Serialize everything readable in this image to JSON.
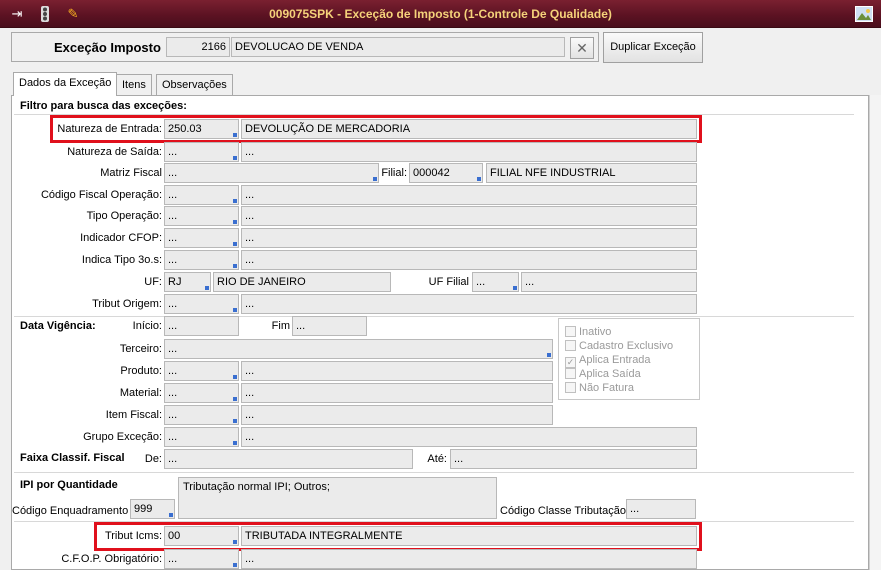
{
  "window": {
    "title": "009075SPK - Exceção de Imposto (1-Controle De Qualidade)",
    "icons": [
      "exit-icon",
      "traffic-light-icon",
      "tools-icon",
      "picture-icon"
    ]
  },
  "header": {
    "label": "Exceção Imposto",
    "code": "2166",
    "description": "DEVOLUCAO DE VENDA",
    "clear_symbol": "✕",
    "duplicate_button": "Duplicar Exceção"
  },
  "tabs": [
    "Dados da Exceção",
    "Itens",
    "Observações"
  ],
  "filter": {
    "section_title": "Filtro para busca das exceções:",
    "natureza_entrada": {
      "label": "Natureza de Entrada:",
      "code": "250.03",
      "desc": "DEVOLUÇÃO DE MERCADORIA"
    },
    "natureza_saida": {
      "label": "Natureza de Saída:",
      "code": "...",
      "desc": "..."
    },
    "matriz_fiscal": {
      "label": "Matriz Fiscal",
      "code": "..."
    },
    "filial": {
      "label": "Filial:",
      "code": "000042",
      "desc": "FILIAL NFE INDUSTRIAL"
    },
    "codigo_fiscal_operacao": {
      "label": "Código Fiscal Operação:",
      "code": "...",
      "desc": "..."
    },
    "tipo_operacao": {
      "label": "Tipo Operação:",
      "code": "...",
      "desc": "..."
    },
    "indicador_cfop": {
      "label": "Indicador CFOP:",
      "code": "...",
      "desc": "..."
    },
    "indica_tipo": {
      "label": "Indica Tipo 3o.s:",
      "code": "...",
      "desc": "..."
    },
    "uf": {
      "label": "UF:",
      "code": "RJ",
      "desc": "RIO DE JANEIRO"
    },
    "uf_filial": {
      "label": "UF Filial",
      "code": "...",
      "desc": "..."
    },
    "tribut_origem": {
      "label": "Tribut Origem:",
      "code": "...",
      "desc": "..."
    }
  },
  "vigencia": {
    "title": "Data Vigência:",
    "inicio_label": "Início:",
    "inicio": "...",
    "fim_label": "Fim",
    "fim": "..."
  },
  "checkboxes": [
    {
      "label": "Inativo",
      "checked": false
    },
    {
      "label": "Cadastro Exclusivo",
      "checked": false
    },
    {
      "label": "Aplica Entrada",
      "checked": true
    },
    {
      "label": "Aplica Saída",
      "checked": false
    },
    {
      "label": "Não Fatura",
      "checked": false
    }
  ],
  "others": {
    "terceiro": {
      "label": "Terceiro:",
      "code": "..."
    },
    "produto": {
      "label": "Produto:",
      "code": "...",
      "desc": "..."
    },
    "material": {
      "label": "Material:",
      "code": "...",
      "desc": "..."
    },
    "item_fiscal": {
      "label": "Item Fiscal:",
      "code": "...",
      "desc": "..."
    },
    "grupo_excecao": {
      "label": "Grupo Exceção:",
      "code": "...",
      "desc": "..."
    }
  },
  "faixa": {
    "title": "Faixa Classif. Fiscal",
    "de_label": "De:",
    "de": "...",
    "ate_label": "Até:",
    "ate": "..."
  },
  "ipi": {
    "title": "IPI por Quantidade",
    "enquadramento_label": "Código Enquadramento",
    "enquadramento": "999",
    "memo": "Tributação normal IPI; Outros;",
    "classe_label": "Código Classe Tributação",
    "classe": "..."
  },
  "icms": {
    "tribut_label": "Tribut Icms:",
    "tribut_code": "00",
    "tribut_desc": "TRIBUTADA INTEGRALMENTE",
    "cfop_label": "C.F.O.P. Obrigatório:",
    "cfop_code": "...",
    "cfop_desc": "..."
  },
  "colors": {
    "title_bg": "#5a1222",
    "title_text": "#f5d27a",
    "highlight": "#e0101c"
  }
}
